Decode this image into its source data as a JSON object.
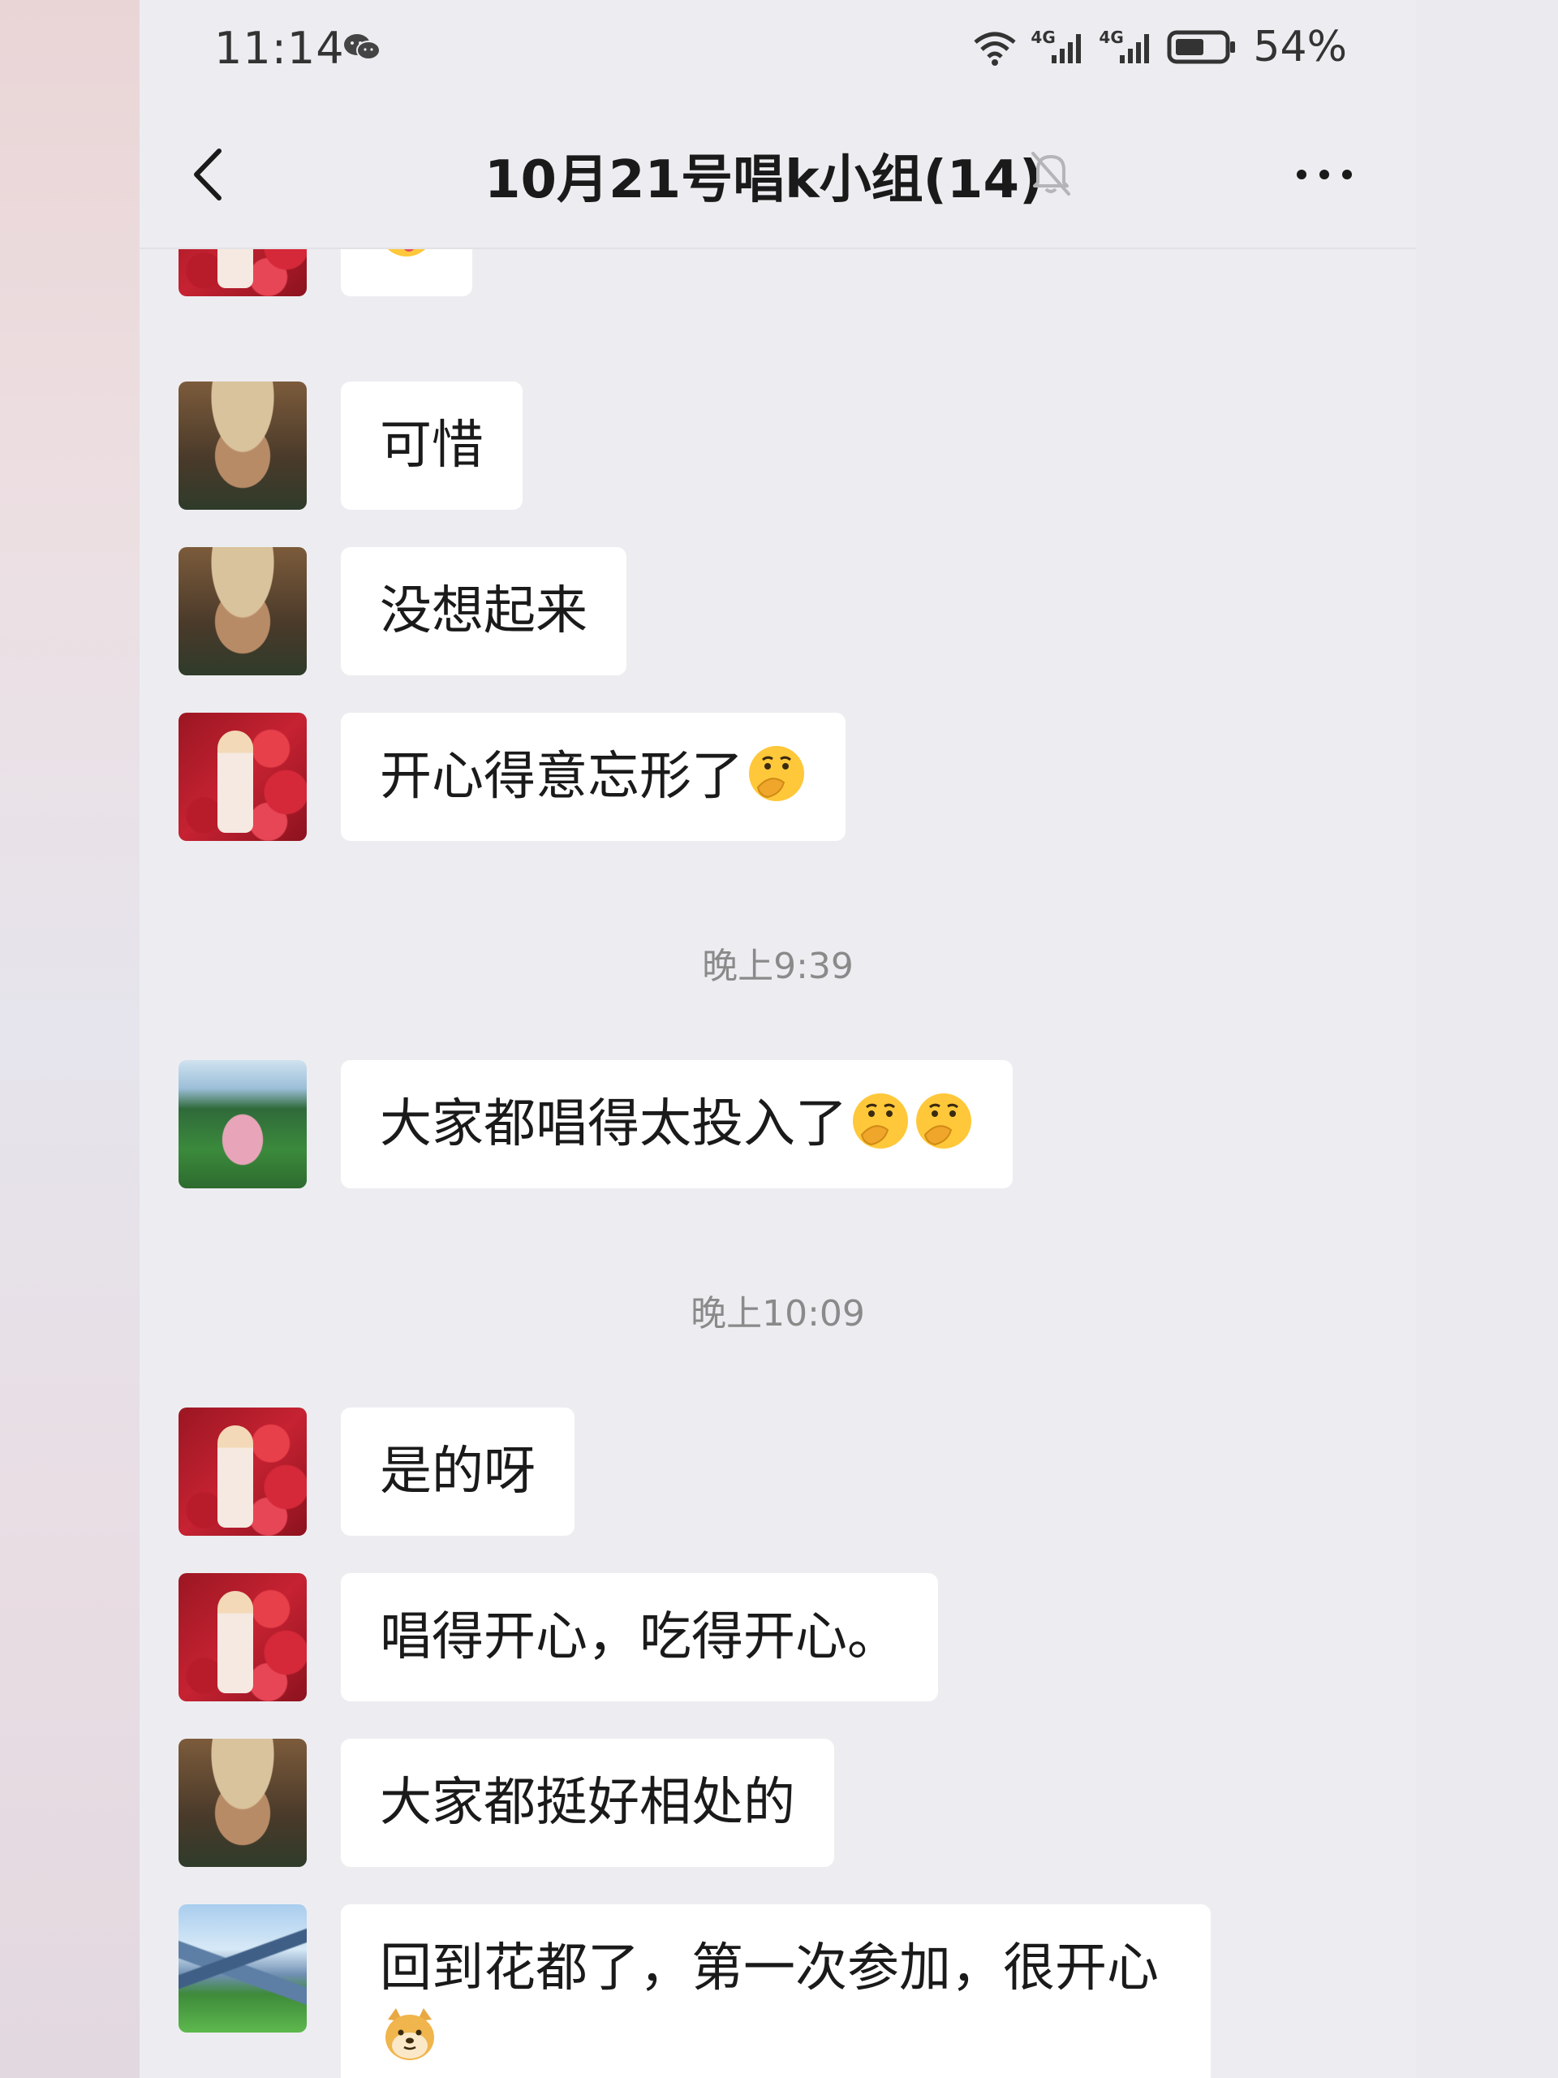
{
  "status_bar": {
    "time": "11:14",
    "network_1": "4G",
    "network_2": "4G",
    "battery": "54%"
  },
  "header": {
    "title": "10月21号唱k小组(14)",
    "back_icon": "chevron-left-icon",
    "mute_icon": "bell-off-icon",
    "more_icon": "more-dots-icon"
  },
  "timestamps": [
    "晚上9:39",
    "晚上10:09"
  ],
  "messages": [
    {
      "text": "",
      "emoji": [
        "wink-tongue"
      ]
    },
    {
      "text": "可惜",
      "emoji": []
    },
    {
      "text": "没想起来",
      "emoji": []
    },
    {
      "text": "开心得意忘形了",
      "emoji": [
        "thinking-hand"
      ]
    },
    {
      "text": "大家都唱得太投入了",
      "emoji": [
        "thinking-hand",
        "thinking-hand"
      ]
    },
    {
      "text": "是的呀",
      "emoji": []
    },
    {
      "text": "唱得开心，吃得开心。",
      "emoji": []
    },
    {
      "text": "大家都挺好相处的",
      "emoji": []
    },
    {
      "text": "回到花都了，第一次参加，很开心",
      "emoji": [
        "doge"
      ]
    }
  ],
  "colors": {
    "chat_background": "#ededf1",
    "bubble": "#ffffff",
    "text": "#1a1a1a",
    "timestamp": "#8a8a8a"
  }
}
